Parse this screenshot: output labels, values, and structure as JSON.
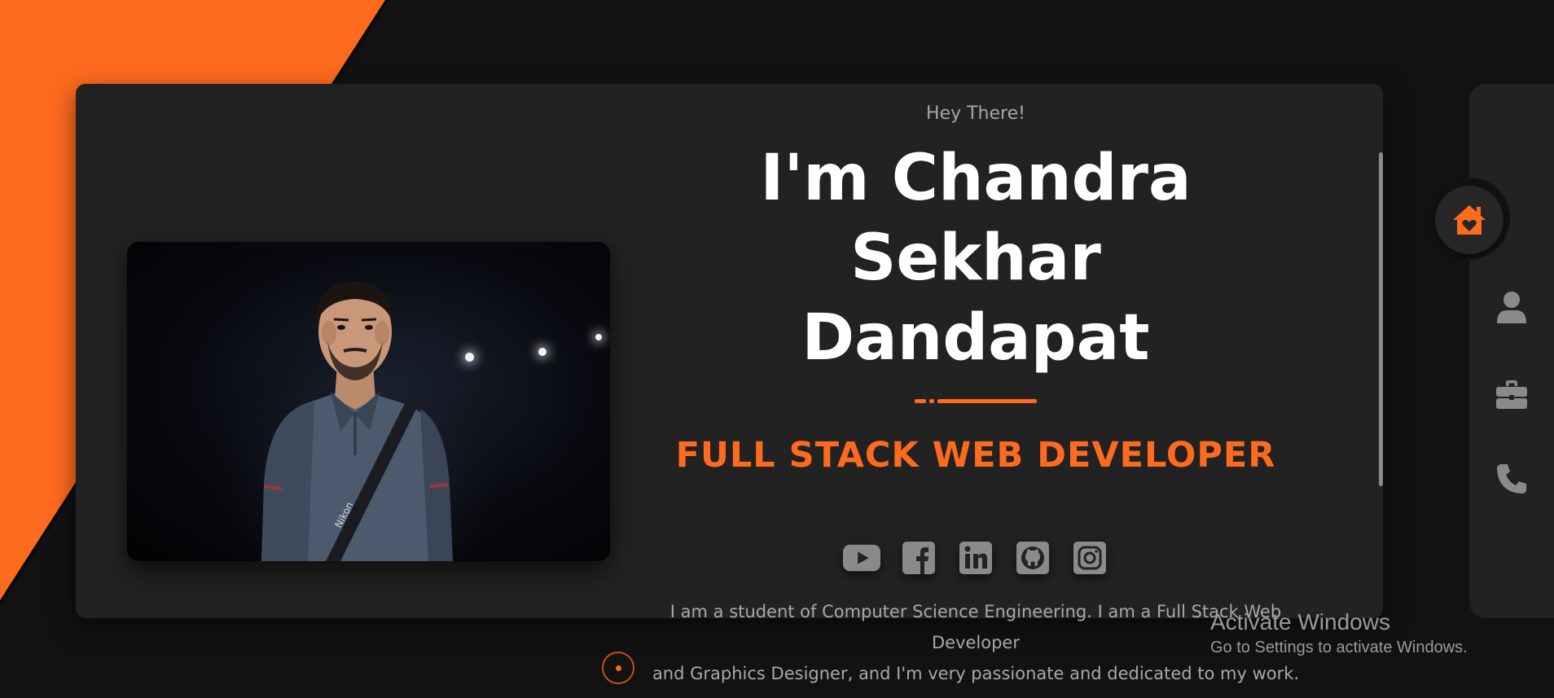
{
  "colors": {
    "accent": "#fe6a1e",
    "background": "#121212",
    "card": "#222222",
    "muted_text": "#a9a9a9",
    "icon_gray": "#8a8a8a"
  },
  "hero": {
    "greeting": "Hey There!",
    "name_line1": "I'm Chandra Sekhar",
    "name_line2": "Dandapat",
    "role": "FULL STACK WEB DEVELOPER",
    "bio_line1": "I am a student of Computer Science Engineering. I am a Full Stack Web Developer",
    "bio_line2": "and Graphics Designer, and I'm very passionate and dedicated to my work.",
    "socials": [
      {
        "icon": "youtube-icon"
      },
      {
        "icon": "facebook-icon"
      },
      {
        "icon": "linkedin-icon"
      },
      {
        "icon": "github-icon"
      },
      {
        "icon": "instagram-icon"
      }
    ],
    "photo_caption": "Nikon"
  },
  "sidebar": {
    "items": [
      {
        "icon": "home-icon",
        "active": true
      },
      {
        "icon": "user-icon",
        "active": false
      },
      {
        "icon": "briefcase-icon",
        "active": false
      },
      {
        "icon": "phone-icon",
        "active": false
      }
    ]
  },
  "os_watermark": {
    "title": "Activate Windows",
    "subtitle": "Go to Settings to activate Windows."
  }
}
